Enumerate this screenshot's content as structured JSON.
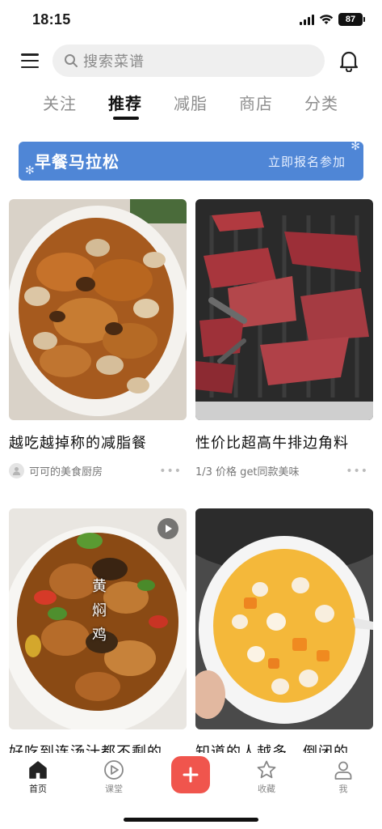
{
  "status": {
    "time": "18:15",
    "battery": "87"
  },
  "header": {
    "search_placeholder": "搜索菜谱"
  },
  "tabs": [
    {
      "label": "关注",
      "active": false
    },
    {
      "label": "推荐",
      "active": true
    },
    {
      "label": "减脂",
      "active": false
    },
    {
      "label": "商店",
      "active": false
    },
    {
      "label": "分类",
      "active": false
    }
  ],
  "banner": {
    "title": "早餐马拉松",
    "cta": "立即报名参加"
  },
  "feed": [
    {
      "title": "越吃越掉称的减脂餐",
      "meta": "可可的美食厨房",
      "has_avatar": true,
      "image": "mushroom-chicken-photo"
    },
    {
      "title": "性价比超高牛排边角料",
      "meta": "1/3 价格 get同款美味",
      "has_avatar": false,
      "image": "grilled-beef-photo"
    },
    {
      "title": "好吃到连汤汁都不剩的",
      "image": "braised-chicken-photo",
      "overlay_text": [
        "黄",
        "焖",
        "鸡"
      ],
      "is_video": true
    },
    {
      "title": "知道的人越多，倒闭的",
      "image": "mango-dessert-photo"
    }
  ],
  "tabbar": [
    {
      "label": "首页",
      "icon": "home-icon",
      "active": true
    },
    {
      "label": "课堂",
      "icon": "play-icon",
      "active": false
    },
    {
      "label": "",
      "icon": "plus-icon",
      "active": false
    },
    {
      "label": "收藏",
      "icon": "star-icon",
      "active": false
    },
    {
      "label": "我",
      "icon": "person-icon",
      "active": false
    }
  ],
  "colors": {
    "accent_red": "#f0554d",
    "banner_blue": "#4f86d6",
    "tab_inactive": "#8e8e8e"
  }
}
